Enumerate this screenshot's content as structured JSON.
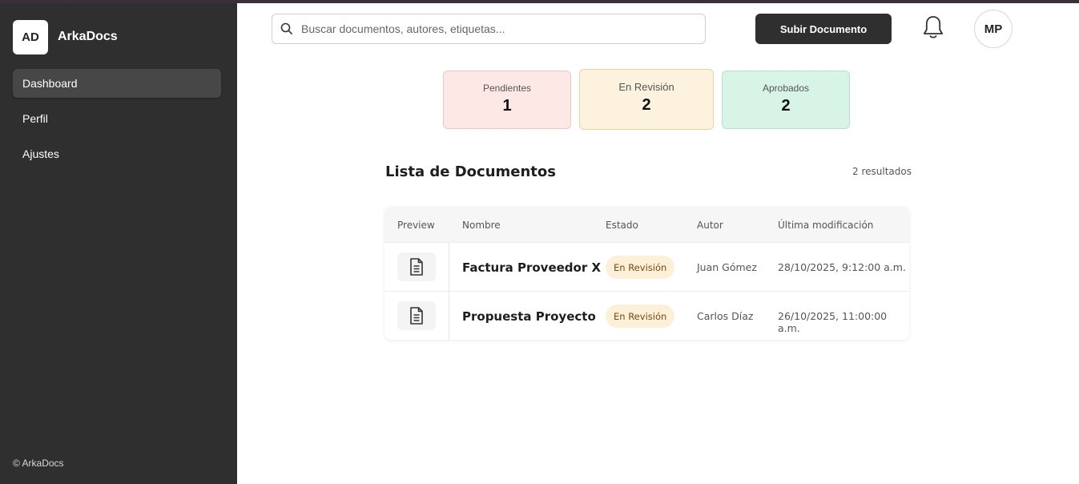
{
  "sidebar": {
    "logo_initials": "AD",
    "app_name": "ArkaDocs",
    "items": [
      {
        "label": "Dashboard",
        "active": true
      },
      {
        "label": "Perfil",
        "active": false
      },
      {
        "label": "Ajustes",
        "active": false
      }
    ],
    "footer": "© ArkaDocs"
  },
  "header": {
    "search_placeholder": "Buscar documentos, autores, etiquetas...",
    "upload_label": "Subir Documento",
    "avatar_initials": "MP"
  },
  "stats": {
    "pending": {
      "label": "Pendientes",
      "value": "1"
    },
    "review": {
      "label": "En Revisión",
      "value": "2"
    },
    "approved": {
      "label": "Aprobados",
      "value": "2"
    }
  },
  "list": {
    "title": "Lista de Documentos",
    "results": "2 resultados",
    "columns": [
      "Preview",
      "Nombre",
      "Estado",
      "Autor",
      "Última modificación"
    ],
    "rows": [
      {
        "name": "Factura Proveedor X",
        "status": "En Revisión",
        "author": "Juan Gómez",
        "modified": "28/10/2025, 9:12:00 a.m."
      },
      {
        "name": "Propuesta Proyecto",
        "status": "En Revisión",
        "author": "Carlos Díaz",
        "modified": "26/10/2025, 11:00:00 a.m."
      }
    ]
  },
  "colors": {
    "sidebar_bg": "#2f2f2f",
    "pending_bg": "#fde8e6",
    "review_bg": "#fdf2dd",
    "approved_bg": "#d7f4e7",
    "badge_bg": "#fdf0d8"
  },
  "icons": [
    "search-icon",
    "bell-icon",
    "document-icon"
  ]
}
